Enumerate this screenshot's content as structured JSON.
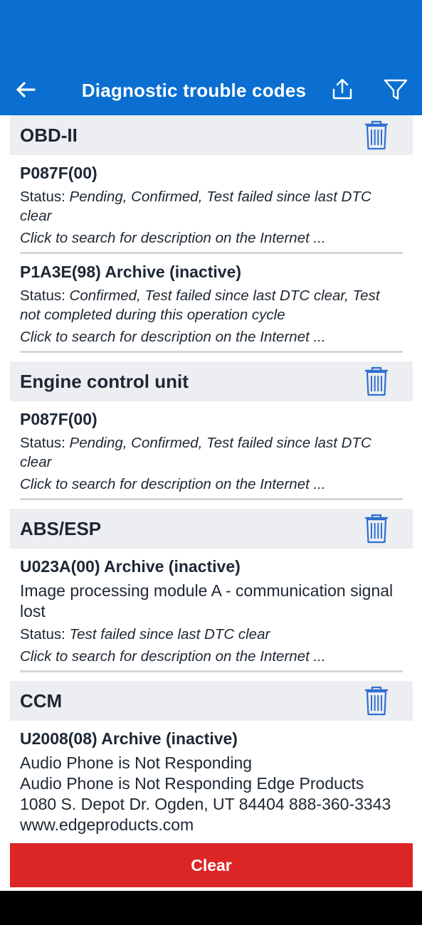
{
  "header": {
    "title": "Diagnostic trouble codes",
    "back_icon": "back-arrow-icon",
    "share_icon": "share-icon",
    "filter_icon": "filter-icon",
    "background": "#0a6fd1"
  },
  "groups": [
    {
      "title": "OBD-II",
      "items": [
        {
          "code": "P087F(00)",
          "status_label": "Status: ",
          "status": "Pending, Confirmed, Test failed since last DTC clear",
          "link": "Click to search for description on the Internet ..."
        },
        {
          "code": "P1A3E(98) Archive (inactive)",
          "status_label": "Status: ",
          "status": "Confirmed, Test failed since last DTC clear, Test not completed during this operation cycle",
          "link": "Click to search for description on the Internet ..."
        }
      ]
    },
    {
      "title": "Engine control unit",
      "items": [
        {
          "code": "P087F(00)",
          "status_label": "Status: ",
          "status": "Pending, Confirmed, Test failed since last DTC clear",
          "link": "Click to search for description on the Internet ..."
        }
      ]
    },
    {
      "title": "ABS/ESP",
      "items": [
        {
          "code": "U023A(00) Archive (inactive)",
          "description": "Image processing module A - communication signal lost",
          "status_label": "Status: ",
          "status": "Test failed since last DTC clear",
          "link": "Click to search for description on the Internet ..."
        }
      ]
    },
    {
      "title": "CCM",
      "items": [
        {
          "code": "U2008(08) Archive (inactive)",
          "description": "Audio Phone is Not Responding\nAudio Phone is Not Responding Edge Products 1080 S. Depot Dr. Ogden, UT 84404 888-360-3343 www.edgeproducts.com"
        }
      ]
    }
  ],
  "footer": {
    "clear_label": "Clear",
    "clear_color": "#dc2626"
  }
}
